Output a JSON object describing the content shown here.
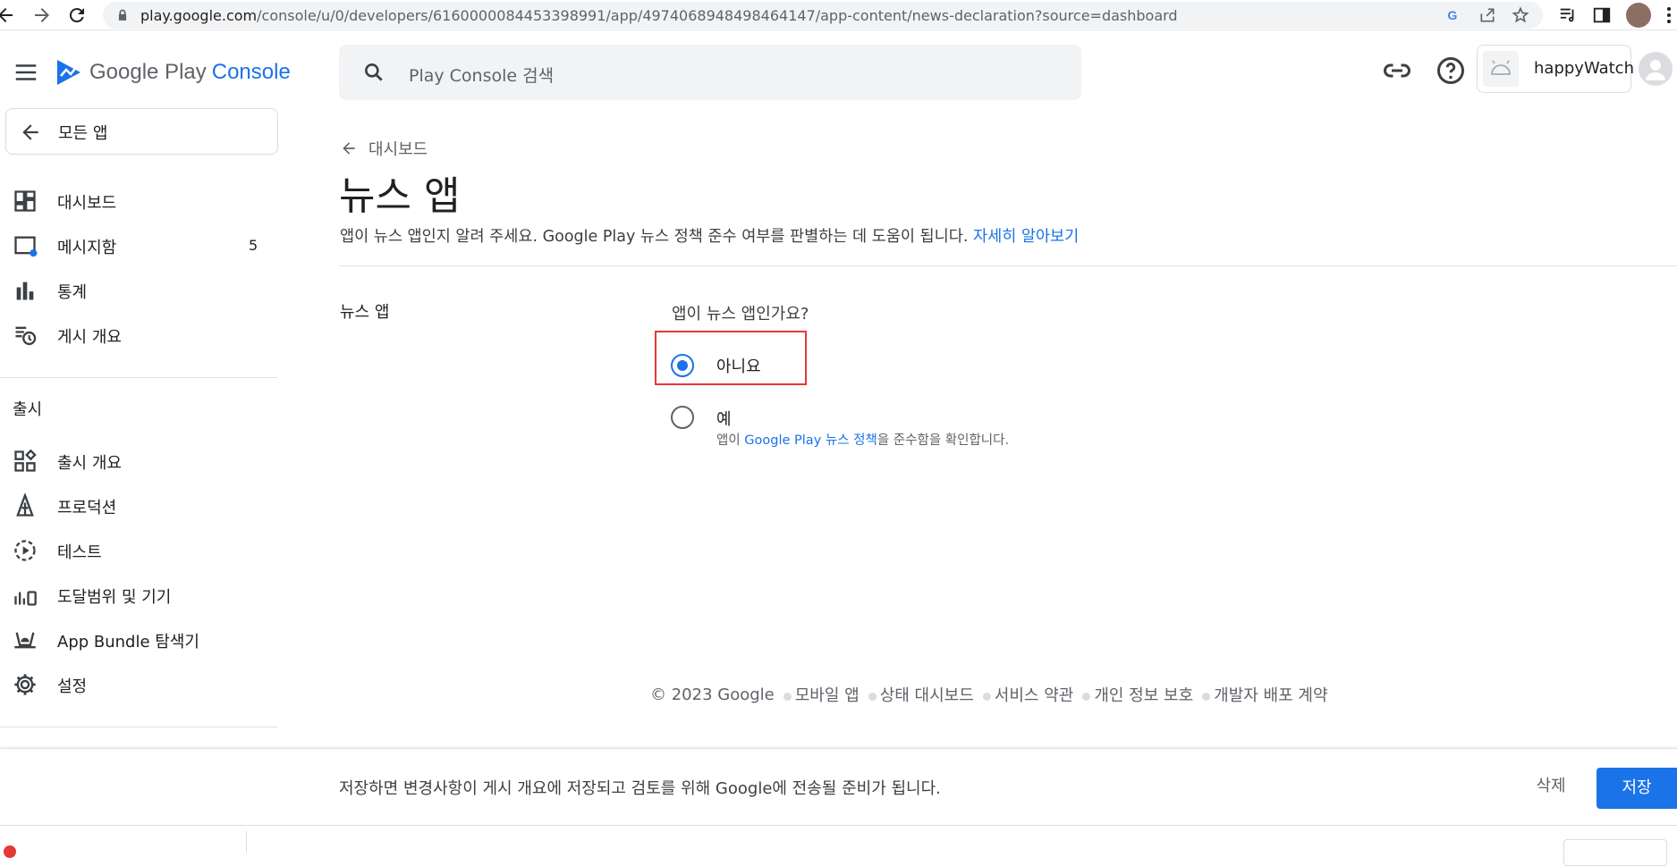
{
  "browser": {
    "url_prefix": "play.google.com",
    "url_rest": "/console/u/0/developers/6160000084453398991/app/4974068948498464147/app-content/news-declaration?source=dashboard"
  },
  "header": {
    "logo_google": "Google Play",
    "logo_console": "Console",
    "search_placeholder": "Play Console 검색",
    "account_name": "happyWatch"
  },
  "sidebar": {
    "back_label": "모든 앱",
    "items": [
      {
        "label": "대시보드",
        "icon": "dashboard-icon"
      },
      {
        "label": "메시지함",
        "icon": "inbox-icon",
        "badge": "5"
      },
      {
        "label": "통계",
        "icon": "statistics-icon"
      },
      {
        "label": "게시 개요",
        "icon": "publishing-overview-icon"
      }
    ],
    "section_title": "출시",
    "release_items": [
      {
        "label": "출시 개요",
        "icon": "release-overview-icon"
      },
      {
        "label": "프로덕션",
        "icon": "production-icon"
      },
      {
        "label": "테스트",
        "icon": "testing-icon"
      },
      {
        "label": "도달범위 및 기기",
        "icon": "reach-devices-icon"
      },
      {
        "label": "App Bundle 탐색기",
        "icon": "app-bundle-icon"
      },
      {
        "label": "설정",
        "icon": "settings-icon"
      }
    ]
  },
  "main": {
    "breadcrumb": "대시보드",
    "title": "뉴스 앱",
    "description": "앱이 뉴스 앱인지 알려 주세요. Google Play 뉴스 정책 준수 여부를 판별하는 데 도움이 됩니다.",
    "learn_more": "자세히 알아보기",
    "section_label": "뉴스 앱",
    "question": "앱이 뉴스 앱인가요?",
    "options": [
      {
        "label": "아니요",
        "selected": true
      },
      {
        "label": "예",
        "selected": false
      }
    ],
    "yes_note_prefix": "앱이 ",
    "yes_note_link": "Google Play 뉴스 정책",
    "yes_note_suffix": "을 준수함을 확인합니다."
  },
  "footer": {
    "copyright": "© 2023 Google",
    "links": [
      "모바일 앱",
      "상태 대시보드",
      "서비스 약관",
      "개인 정보 보호",
      "개발자 배포 계약"
    ]
  },
  "savebar": {
    "message": "저장하면 변경사항이 게시 개요에 저장되고 검토를 위해 Google에 전송될 준비가 됩니다.",
    "delete_label": "삭제",
    "save_label": "저장"
  },
  "colors": {
    "accent": "#1a73e8",
    "highlight": "#e53935"
  }
}
